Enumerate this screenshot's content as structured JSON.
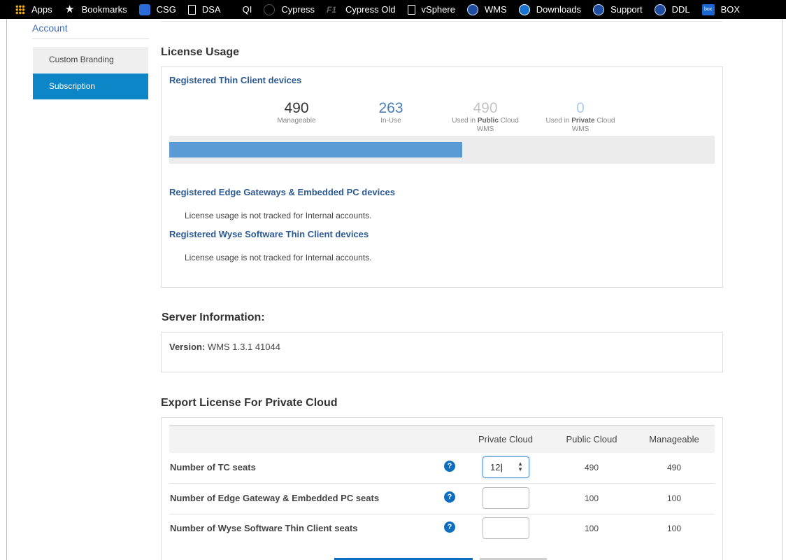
{
  "bookmarks": [
    {
      "label": "Apps",
      "icon": "apps-icon"
    },
    {
      "label": "Bookmarks",
      "icon": "star-icon"
    },
    {
      "label": "CSG",
      "icon": "csg-icon"
    },
    {
      "label": "DSA",
      "icon": "page-icon"
    },
    {
      "label": "QI",
      "icon": "folder-icon"
    },
    {
      "label": "Cypress",
      "icon": "cypress-icon"
    },
    {
      "label": "Cypress Old",
      "icon": "f1-icon"
    },
    {
      "label": "vSphere",
      "icon": "page-icon"
    },
    {
      "label": "WMS",
      "icon": "dell-icon"
    },
    {
      "label": "Downloads",
      "icon": "download-icon"
    },
    {
      "label": "Support",
      "icon": "dell-icon"
    },
    {
      "label": "DDL",
      "icon": "dell-icon"
    },
    {
      "label": "BOX",
      "icon": "box-icon"
    }
  ],
  "sidebar": {
    "title": "Account",
    "items": [
      {
        "label": "Custom Branding",
        "active": false
      },
      {
        "label": "Subscription",
        "active": true
      }
    ]
  },
  "license_usage": {
    "heading": "License Usage",
    "thin_client": {
      "title": "Registered Thin Client devices",
      "stats": [
        {
          "value": "490",
          "label": "Manageable"
        },
        {
          "value": "263",
          "label": "In-Use"
        },
        {
          "value": "490",
          "label_pre": "Used in",
          "label_bold": "Public",
          "label_post": "Cloud",
          "label_line2": "WMS"
        },
        {
          "value": "0",
          "label_pre": "Used in",
          "label_bold": "Private",
          "label_post": "Cloud",
          "label_line2": "WMS"
        }
      ],
      "usage_fraction": 0.537
    },
    "edge": {
      "title": "Registered Edge Gateways & Embedded PC devices",
      "note": "License usage is not tracked for Internal accounts."
    },
    "wyse": {
      "title": "Registered Wyse Software Thin Client devices",
      "note": "License usage is not tracked for Internal accounts."
    }
  },
  "server_info": {
    "heading": "Server Information:",
    "version_label": "Version:",
    "version_value": "WMS 1.3.1 41044"
  },
  "export": {
    "heading": "Export License For Private Cloud",
    "columns": [
      "Private Cloud",
      "Public Cloud",
      "Manageable"
    ],
    "rows": [
      {
        "label": "Number of TC seats",
        "private": "12",
        "public": "490",
        "manageable": "490"
      },
      {
        "label": "Number of Edge Gateway & Embedded PC seats",
        "private": "",
        "public": "100",
        "manageable": "100"
      },
      {
        "label": "Number of Wyse Software Thin Client seats",
        "private": "",
        "public": "100",
        "manageable": "100"
      }
    ],
    "help_glyph": "?"
  },
  "colors": {
    "accent": "#0d86c8",
    "bar": "#5b9bd5",
    "link": "#2c5a93"
  }
}
